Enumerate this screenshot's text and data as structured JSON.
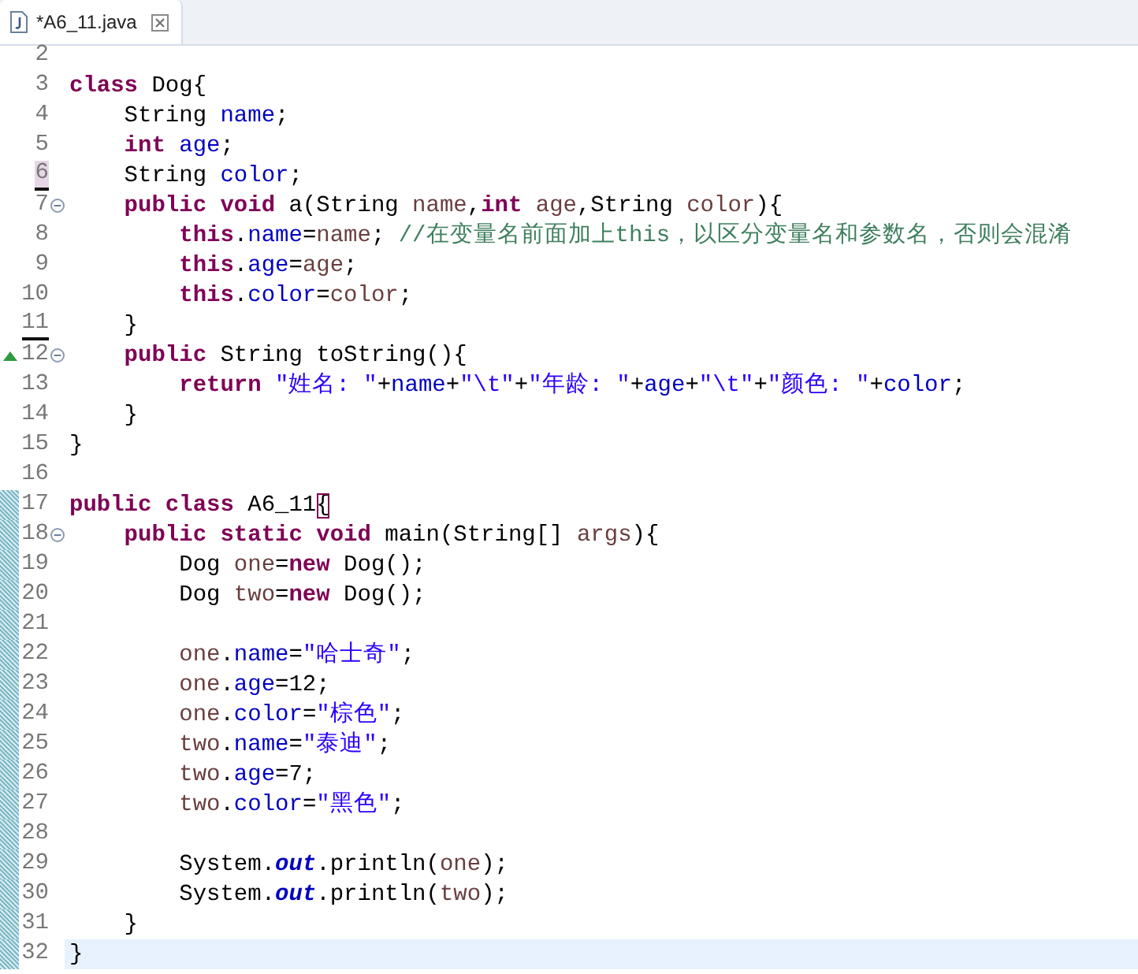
{
  "tab": {
    "title": "*A6_11.java",
    "selected": true
  },
  "lines": [
    {
      "number": "2",
      "changed": false,
      "current": false,
      "underlined": false,
      "foldable": false
    },
    {
      "number": "3",
      "changed": false,
      "current": false,
      "underlined": false,
      "foldable": false,
      "tokens": [
        {
          "kind": "keyword",
          "text": "class"
        },
        {
          "kind": "plain",
          "text": " Dog{"
        }
      ]
    },
    {
      "number": "4",
      "changed": false,
      "current": false,
      "underlined": false,
      "foldable": false,
      "tokens": [
        {
          "kind": "plain",
          "text": "    String "
        },
        {
          "kind": "field",
          "text": "name"
        },
        {
          "kind": "plain",
          "text": ";"
        }
      ]
    },
    {
      "number": "5",
      "changed": false,
      "current": false,
      "underlined": false,
      "foldable": false,
      "tokens": [
        {
          "kind": "keyword",
          "text": "    int"
        },
        {
          "kind": "field",
          "text": " age"
        },
        {
          "kind": "plain",
          "text": ";"
        }
      ]
    },
    {
      "number": "6",
      "changed": false,
      "current": false,
      "underlined": true,
      "highlighted": true,
      "foldable": false,
      "tokens": [
        {
          "kind": "plain",
          "text": "    String "
        },
        {
          "kind": "field",
          "text": "color"
        },
        {
          "kind": "plain",
          "text": ";"
        }
      ]
    },
    {
      "number": "7",
      "changed": false,
      "current": false,
      "underlined": false,
      "foldable": true,
      "tokens": [
        {
          "kind": "keyword",
          "text": "    public void"
        },
        {
          "kind": "plain",
          "text": " a(String "
        },
        {
          "kind": "local",
          "text": "name"
        },
        {
          "kind": "plain",
          "text": ","
        },
        {
          "kind": "keyword",
          "text": "int"
        },
        {
          "kind": "local",
          "text": " age"
        },
        {
          "kind": "plain",
          "text": ",String "
        },
        {
          "kind": "local",
          "text": "color"
        },
        {
          "kind": "plain",
          "text": "){"
        }
      ]
    },
    {
      "number": "8",
      "changed": false,
      "current": false,
      "underlined": false,
      "foldable": false,
      "tokens": [
        {
          "kind": "keyword",
          "text": "        this"
        },
        {
          "kind": "plain",
          "text": "."
        },
        {
          "kind": "field",
          "text": "name"
        },
        {
          "kind": "plain",
          "text": "="
        },
        {
          "kind": "local",
          "text": "name"
        },
        {
          "kind": "plain",
          "text": "; "
        },
        {
          "kind": "comment",
          "text": "//在变量名前面加上this，以区分变量名和参数名，否则会混淆"
        }
      ]
    },
    {
      "number": "9",
      "changed": false,
      "current": false,
      "underlined": false,
      "foldable": false,
      "tokens": [
        {
          "kind": "keyword",
          "text": "        this"
        },
        {
          "kind": "plain",
          "text": "."
        },
        {
          "kind": "field",
          "text": "age"
        },
        {
          "kind": "plain",
          "text": "="
        },
        {
          "kind": "local",
          "text": "age"
        },
        {
          "kind": "plain",
          "text": ";"
        }
      ]
    },
    {
      "number": "10",
      "changed": false,
      "current": false,
      "underlined": false,
      "foldable": false,
      "tokens": [
        {
          "kind": "keyword",
          "text": "        this"
        },
        {
          "kind": "plain",
          "text": "."
        },
        {
          "kind": "field",
          "text": "color"
        },
        {
          "kind": "plain",
          "text": "="
        },
        {
          "kind": "local",
          "text": "color"
        },
        {
          "kind": "plain",
          "text": ";"
        }
      ]
    },
    {
      "number": "11",
      "changed": false,
      "current": false,
      "underlined": true,
      "foldable": false,
      "tokens": [
        {
          "kind": "plain",
          "text": "    }"
        }
      ]
    },
    {
      "number": "12",
      "changed": false,
      "current": false,
      "underlined": false,
      "override": true,
      "foldable": true,
      "tokens": [
        {
          "kind": "keyword",
          "text": "    public"
        },
        {
          "kind": "plain",
          "text": " String toString(){"
        }
      ]
    },
    {
      "number": "13",
      "changed": false,
      "current": false,
      "underlined": false,
      "foldable": false,
      "tokens": [
        {
          "kind": "keyword",
          "text": "        return"
        },
        {
          "kind": "string",
          "text": " \"姓名: \""
        },
        {
          "kind": "plain",
          "text": "+"
        },
        {
          "kind": "field",
          "text": "name"
        },
        {
          "kind": "plain",
          "text": "+"
        },
        {
          "kind": "string",
          "text": "\"\\t\""
        },
        {
          "kind": "plain",
          "text": "+"
        },
        {
          "kind": "string",
          "text": "\"年龄: \""
        },
        {
          "kind": "plain",
          "text": "+"
        },
        {
          "kind": "field",
          "text": "age"
        },
        {
          "kind": "plain",
          "text": "+"
        },
        {
          "kind": "string",
          "text": "\"\\t\""
        },
        {
          "kind": "plain",
          "text": "+"
        },
        {
          "kind": "string",
          "text": "\"颜色: \""
        },
        {
          "kind": "plain",
          "text": "+"
        },
        {
          "kind": "field",
          "text": "color"
        },
        {
          "kind": "plain",
          "text": ";"
        }
      ]
    },
    {
      "number": "14",
      "changed": false,
      "current": false,
      "underlined": false,
      "foldable": false,
      "tokens": [
        {
          "kind": "plain",
          "text": "    }"
        }
      ]
    },
    {
      "number": "15",
      "changed": false,
      "current": false,
      "underlined": false,
      "foldable": false,
      "tokens": [
        {
          "kind": "plain",
          "text": "}"
        }
      ]
    },
    {
      "number": "16",
      "changed": false,
      "current": false,
      "underlined": false,
      "foldable": false
    },
    {
      "number": "17",
      "changed": true,
      "current": false,
      "underlined": false,
      "foldable": false,
      "tokens": [
        {
          "kind": "keyword",
          "text": "public class"
        },
        {
          "kind": "plain",
          "text": " A6_11"
        },
        {
          "kind": "bracket",
          "text": "{"
        }
      ]
    },
    {
      "number": "18",
      "changed": true,
      "current": false,
      "underlined": false,
      "foldable": true,
      "tokens": [
        {
          "kind": "keyword",
          "text": "    public static void"
        },
        {
          "kind": "plain",
          "text": " main(String[] "
        },
        {
          "kind": "local",
          "text": "args"
        },
        {
          "kind": "plain",
          "text": "){"
        }
      ]
    },
    {
      "number": "19",
      "changed": true,
      "current": false,
      "underlined": false,
      "foldable": false,
      "tokens": [
        {
          "kind": "plain",
          "text": "        Dog "
        },
        {
          "kind": "local",
          "text": "one"
        },
        {
          "kind": "plain",
          "text": "="
        },
        {
          "kind": "keyword",
          "text": "new"
        },
        {
          "kind": "plain",
          "text": " Dog();"
        }
      ]
    },
    {
      "number": "20",
      "changed": true,
      "current": false,
      "underlined": false,
      "foldable": false,
      "tokens": [
        {
          "kind": "plain",
          "text": "        Dog "
        },
        {
          "kind": "local",
          "text": "two"
        },
        {
          "kind": "plain",
          "text": "="
        },
        {
          "kind": "keyword",
          "text": "new"
        },
        {
          "kind": "plain",
          "text": " Dog();"
        }
      ]
    },
    {
      "number": "21",
      "changed": true,
      "current": false,
      "underlined": false,
      "foldable": false
    },
    {
      "number": "22",
      "changed": true,
      "current": false,
      "underlined": false,
      "foldable": false,
      "tokens": [
        {
          "kind": "local",
          "text": "        one"
        },
        {
          "kind": "plain",
          "text": "."
        },
        {
          "kind": "field",
          "text": "name"
        },
        {
          "kind": "plain",
          "text": "="
        },
        {
          "kind": "string",
          "text": "\"哈士奇\""
        },
        {
          "kind": "plain",
          "text": ";"
        }
      ]
    },
    {
      "number": "23",
      "changed": true,
      "current": false,
      "underlined": false,
      "foldable": false,
      "tokens": [
        {
          "kind": "local",
          "text": "        one"
        },
        {
          "kind": "plain",
          "text": "."
        },
        {
          "kind": "field",
          "text": "age"
        },
        {
          "kind": "plain",
          "text": "=12;"
        }
      ]
    },
    {
      "number": "24",
      "changed": true,
      "current": false,
      "underlined": false,
      "foldable": false,
      "tokens": [
        {
          "kind": "local",
          "text": "        one"
        },
        {
          "kind": "plain",
          "text": "."
        },
        {
          "kind": "field",
          "text": "color"
        },
        {
          "kind": "plain",
          "text": "="
        },
        {
          "kind": "string",
          "text": "\"棕色\""
        },
        {
          "kind": "plain",
          "text": ";"
        }
      ]
    },
    {
      "number": "25",
      "changed": true,
      "current": false,
      "underlined": false,
      "foldable": false,
      "tokens": [
        {
          "kind": "local",
          "text": "        two"
        },
        {
          "kind": "plain",
          "text": "."
        },
        {
          "kind": "field",
          "text": "name"
        },
        {
          "kind": "plain",
          "text": "="
        },
        {
          "kind": "string",
          "text": "\"泰迪\""
        },
        {
          "kind": "plain",
          "text": ";"
        }
      ]
    },
    {
      "number": "26",
      "changed": true,
      "current": false,
      "underlined": false,
      "foldable": false,
      "tokens": [
        {
          "kind": "local",
          "text": "        two"
        },
        {
          "kind": "plain",
          "text": "."
        },
        {
          "kind": "field",
          "text": "age"
        },
        {
          "kind": "plain",
          "text": "=7;"
        }
      ]
    },
    {
      "number": "27",
      "changed": true,
      "current": false,
      "underlined": false,
      "foldable": false,
      "tokens": [
        {
          "kind": "local",
          "text": "        two"
        },
        {
          "kind": "plain",
          "text": "."
        },
        {
          "kind": "field",
          "text": "color"
        },
        {
          "kind": "plain",
          "text": "="
        },
        {
          "kind": "string",
          "text": "\"黑色\""
        },
        {
          "kind": "plain",
          "text": ";"
        }
      ]
    },
    {
      "number": "28",
      "changed": true,
      "current": false,
      "underlined": false,
      "foldable": false
    },
    {
      "number": "29",
      "changed": true,
      "current": false,
      "underlined": false,
      "foldable": false,
      "tokens": [
        {
          "kind": "plain",
          "text": "        System."
        },
        {
          "kind": "static",
          "text": "out"
        },
        {
          "kind": "plain",
          "text": ".println("
        },
        {
          "kind": "local",
          "text": "one"
        },
        {
          "kind": "plain",
          "text": ");"
        }
      ]
    },
    {
      "number": "30",
      "changed": true,
      "current": false,
      "underlined": false,
      "foldable": false,
      "tokens": [
        {
          "kind": "plain",
          "text": "        System."
        },
        {
          "kind": "static",
          "text": "out"
        },
        {
          "kind": "plain",
          "text": ".println("
        },
        {
          "kind": "local",
          "text": "two"
        },
        {
          "kind": "plain",
          "text": ");"
        }
      ]
    },
    {
      "number": "31",
      "changed": true,
      "current": false,
      "underlined": false,
      "foldable": false,
      "tokens": [
        {
          "kind": "plain",
          "text": "    }"
        }
      ]
    },
    {
      "number": "32",
      "changed": true,
      "current": true,
      "underlined": false,
      "foldable": false,
      "tokens": [
        {
          "kind": "plain",
          "text": "}"
        }
      ]
    }
  ]
}
